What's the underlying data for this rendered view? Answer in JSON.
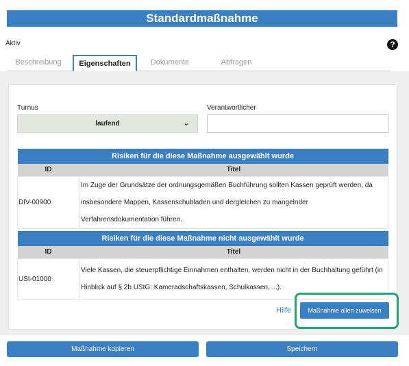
{
  "header": {
    "title": "Standardmaßnahme"
  },
  "status": "Aktiv",
  "help_icon": "question-circle-icon",
  "tabs": [
    {
      "label": "Beschreibung",
      "active": false
    },
    {
      "label": "Eigenschaften",
      "active": true
    },
    {
      "label": "Dokumente",
      "active": false
    },
    {
      "label": "Abfragen",
      "active": false
    }
  ],
  "form": {
    "turnus_label": "Turnus",
    "turnus_value": "laufend",
    "verantwortlicher_label": "Verantwortlicher",
    "verantwortlicher_value": ""
  },
  "selected_risks": {
    "caption": "Risiken für die diese Maßnahme ausgewählt wurde",
    "columns": [
      "ID",
      "Titel"
    ],
    "rows": [
      {
        "id": "DIV-00900",
        "titel": "Im Zuge der Grundsätze der ordnungsgemäßen Buchführung sollten Kassen geprüft werden, da insbesondere Mappen, Kassenschubladen und dergleichen zu mangelnder Verfahrensdokumentation führen."
      }
    ]
  },
  "unselected_risks": {
    "caption": "Risiken für die diese Maßnahme nicht ausgewählt wurde",
    "columns": [
      "ID",
      "Titel"
    ],
    "rows": [
      {
        "id": "USt-01000",
        "titel": "Viele Kassen, die steuerpflichtige Einnahmen enthalten, werden nicht in der Buchhaltung geführt (in Hinblick auf § 2b UStG: Kameradschaftskassen, Schulkassen, ...)."
      }
    ]
  },
  "actions": {
    "hilfe": "Hilfe",
    "assign_all": "Maßnahme allen zuweisen",
    "copy": "Maßnahme kopieren",
    "save": "Speichern"
  },
  "colors": {
    "primary": "#3a7fc1",
    "highlight": "#21a67a"
  }
}
